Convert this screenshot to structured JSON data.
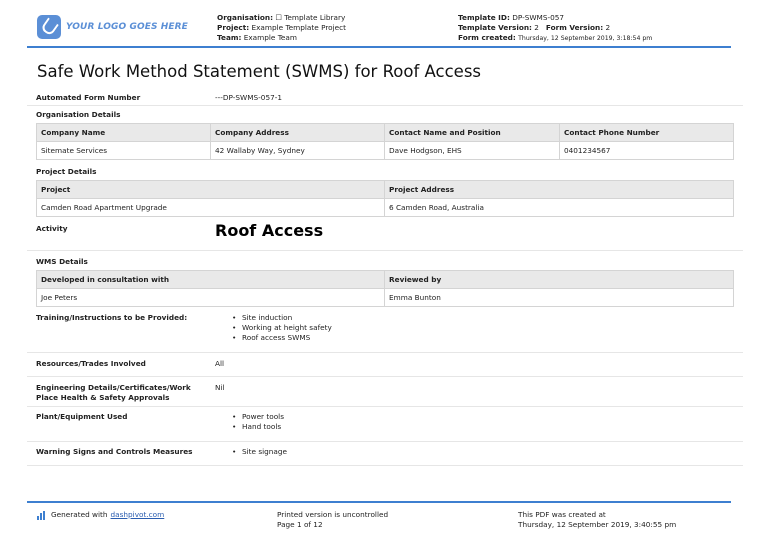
{
  "header": {
    "logo_text": "YOUR LOGO GOES HERE",
    "organisation_label": "Organisation:",
    "organisation_value": "☐ Template Library",
    "project_label": "Project:",
    "project_value": "Example Template Project",
    "team_label": "Team:",
    "team_value": "Example Team",
    "template_id_label": "Template ID:",
    "template_id_value": "DP-SWMS-057",
    "template_version_label": "Template Version:",
    "template_version_value": "2",
    "form_version_label": "Form Version:",
    "form_version_value": "2",
    "form_created_label": "Form created:",
    "form_created_value": "Thursday, 12 September 2019, 3:18:54 pm"
  },
  "title": "Safe Work Method Statement (SWMS) for Roof Access",
  "form_number": {
    "label": "Automated Form Number",
    "value": "---DP-SWMS-057-1"
  },
  "organisation_details": {
    "heading": "Organisation Details",
    "columns": [
      "Company Name",
      "Company Address",
      "Contact Name and Position",
      "Contact Phone Number"
    ],
    "row": [
      "Sitemate Services",
      "42 Wallaby Way, Sydney",
      "Dave Hodgson, EHS",
      "0401234567"
    ]
  },
  "project_details": {
    "heading": "Project Details",
    "columns": [
      "Project",
      "Project Address"
    ],
    "row": [
      "Camden Road Apartment Upgrade",
      "6 Camden Road, Australia"
    ]
  },
  "activity": {
    "label": "Activity",
    "value": "Roof Access"
  },
  "wms_details": {
    "heading": "WMS Details",
    "columns": [
      "Developed in consultation with",
      "Reviewed by"
    ],
    "row": [
      "Joe Peters",
      "Emma Bunton"
    ]
  },
  "training": {
    "label": "Training/Instructions to be Provided:",
    "items": [
      "Site induction",
      "Working at height safety",
      "Roof access SWMS"
    ]
  },
  "resources": {
    "label": "Resources/Trades Involved",
    "value": "All"
  },
  "engineering": {
    "label_line1": "Engineering Details/Certificates/Work",
    "label_line2": "Place Health & Safety Approvals",
    "value": "Nil"
  },
  "plant": {
    "label": "Plant/Equipment Used",
    "items": [
      "Power tools",
      "Hand tools"
    ]
  },
  "warning": {
    "label": "Warning Signs and Controls Measures",
    "items": [
      "Site signage"
    ]
  },
  "footer": {
    "generated_text": "Generated with",
    "generated_link": "dashpivot.com",
    "printed_line1": "Printed version is uncontrolled",
    "printed_line2": "Page 1 of 12",
    "created_line1": "This PDF was created at",
    "created_line2": "Thursday, 12 September 2019, 3:40:55 pm"
  },
  "colors": {
    "accent": "#3d7fd0",
    "logo": "#5b8fd6",
    "table_header_bg": "#e9e9e9"
  }
}
